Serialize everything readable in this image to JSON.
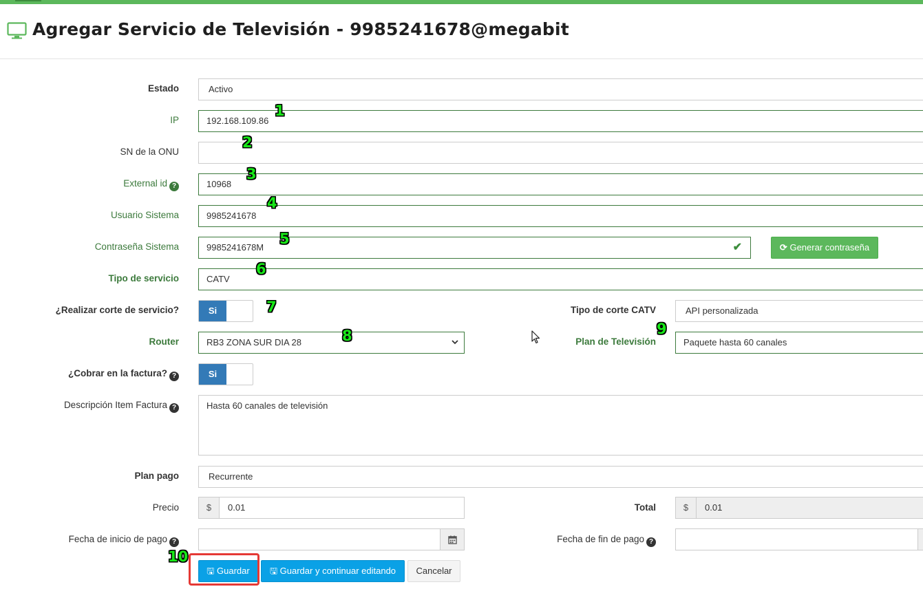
{
  "header": {
    "title": "Agregar Servicio de Televisión - 9985241678@megabit",
    "icon": "tv-icon"
  },
  "form": {
    "estado": {
      "label": "Estado",
      "value": "Activo"
    },
    "ip": {
      "label": "IP",
      "value": "192.168.109.86"
    },
    "sn_onu": {
      "label": "SN de la ONU",
      "value": ""
    },
    "external_id": {
      "label": "External id",
      "value": "10968"
    },
    "usuario": {
      "label": "Usuario Sistema",
      "value": "9985241678"
    },
    "contrasena": {
      "label": "Contraseña Sistema",
      "value": "9985241678M",
      "generate_label": "Generar contraseña"
    },
    "tipo_servicio": {
      "label": "Tipo de servicio",
      "value": "CATV"
    },
    "corte": {
      "label": "¿Realizar corte de servicio?",
      "toggle": "Si"
    },
    "tipo_corte": {
      "label": "Tipo de corte CATV",
      "value": "API personalizada"
    },
    "router": {
      "label": "Router",
      "value": "RB3 ZONA SUR DIA 28"
    },
    "plan_tv": {
      "label": "Plan de Televisión",
      "value": "Paquete hasta 60 canales"
    },
    "cobrar": {
      "label": "¿Cobrar en la factura?",
      "toggle": "Si"
    },
    "descripcion": {
      "label": "Descripción Item Factura",
      "value": "Hasta 60 canales de televisión"
    },
    "plan_pago": {
      "label": "Plan pago",
      "value": "Recurrente"
    },
    "precio": {
      "label": "Precio",
      "currency": "$",
      "value": "0.01"
    },
    "total": {
      "label": "Total",
      "currency": "$",
      "value": "0.01"
    },
    "fecha_inicio": {
      "label": "Fecha de inicio de pago",
      "value": ""
    },
    "fecha_fin": {
      "label": "Fecha de fin de pago",
      "value": ""
    }
  },
  "actions": {
    "save": "Guardar",
    "save_continue": "Guardar y continuar editando",
    "cancel": "Cancelar"
  },
  "annotations": [
    "1",
    "2",
    "3",
    "4",
    "5",
    "6",
    "7",
    "8",
    "9",
    "10"
  ],
  "colors": {
    "accent_green": "#5cb85c",
    "primary_blue": "#337ab7",
    "save_blue": "#0aa1e6",
    "highlight_red": "#e53935"
  }
}
